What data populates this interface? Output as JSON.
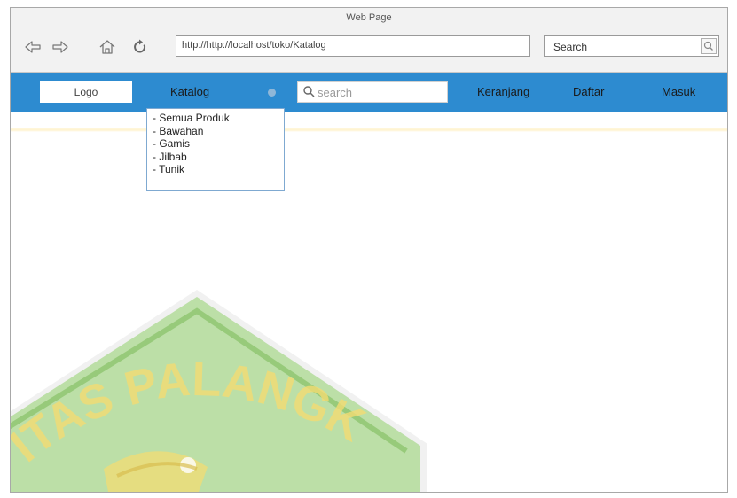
{
  "window": {
    "title": "Web Page"
  },
  "browser": {
    "address": "http://http://localhost/toko/Katalog",
    "search_value": "Search",
    "back_icon": "arrow-left-icon",
    "forward_icon": "arrow-right-icon",
    "home_icon": "home-icon",
    "refresh_icon": "refresh-icon",
    "search_icon": "search-icon"
  },
  "site": {
    "logo_label": "Logo",
    "menu_catalog_label": "Katalog",
    "search_placeholder": "search",
    "menu_cart_label": "Keranjang",
    "menu_register_label": "Daftar",
    "menu_login_label": "Masuk",
    "nav_color": "#2d8bd0"
  },
  "catalog_dropdown": {
    "items": [
      "- Semua Produk",
      "- Bawahan",
      "- Gamis",
      "- Jilbab",
      "- Tunik"
    ]
  },
  "watermark": {
    "text": "ITAS PALANGK",
    "color_green": "#8fcf6a",
    "color_yellow": "#f3dc73"
  }
}
